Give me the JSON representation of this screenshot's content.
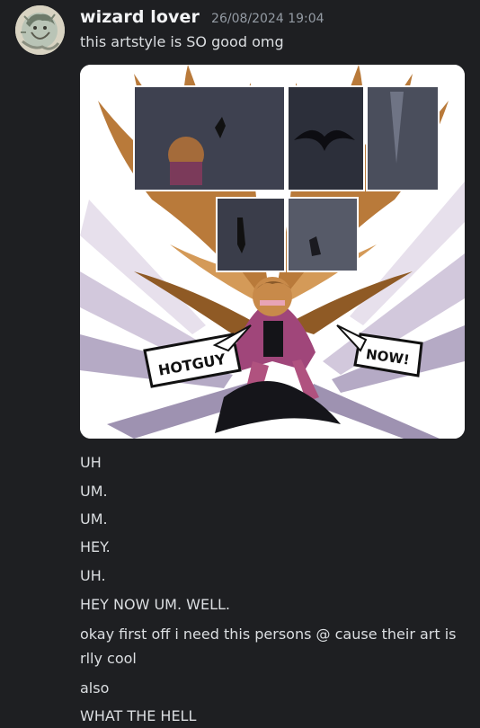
{
  "message": {
    "username": "wizard lover",
    "timestamp": "26/08/2024 19:04",
    "first_line": "this artstyle is SO good omg",
    "image": {
      "bubble_left": "HOTGUY",
      "bubble_right": "NOW!"
    },
    "lines": [
      "UH",
      "UM.",
      "UM.",
      "HEY.",
      "UH.",
      "HEY NOW UM. WELL.",
      "okay first off i need this persons @ cause their art is rlly cool",
      "also",
      "WHAT THE HELL"
    ]
  },
  "colors": {
    "background": "#1e1f22",
    "username": "#f2f3f5",
    "timestamp": "#949ba4",
    "text": "#dbdee1"
  }
}
